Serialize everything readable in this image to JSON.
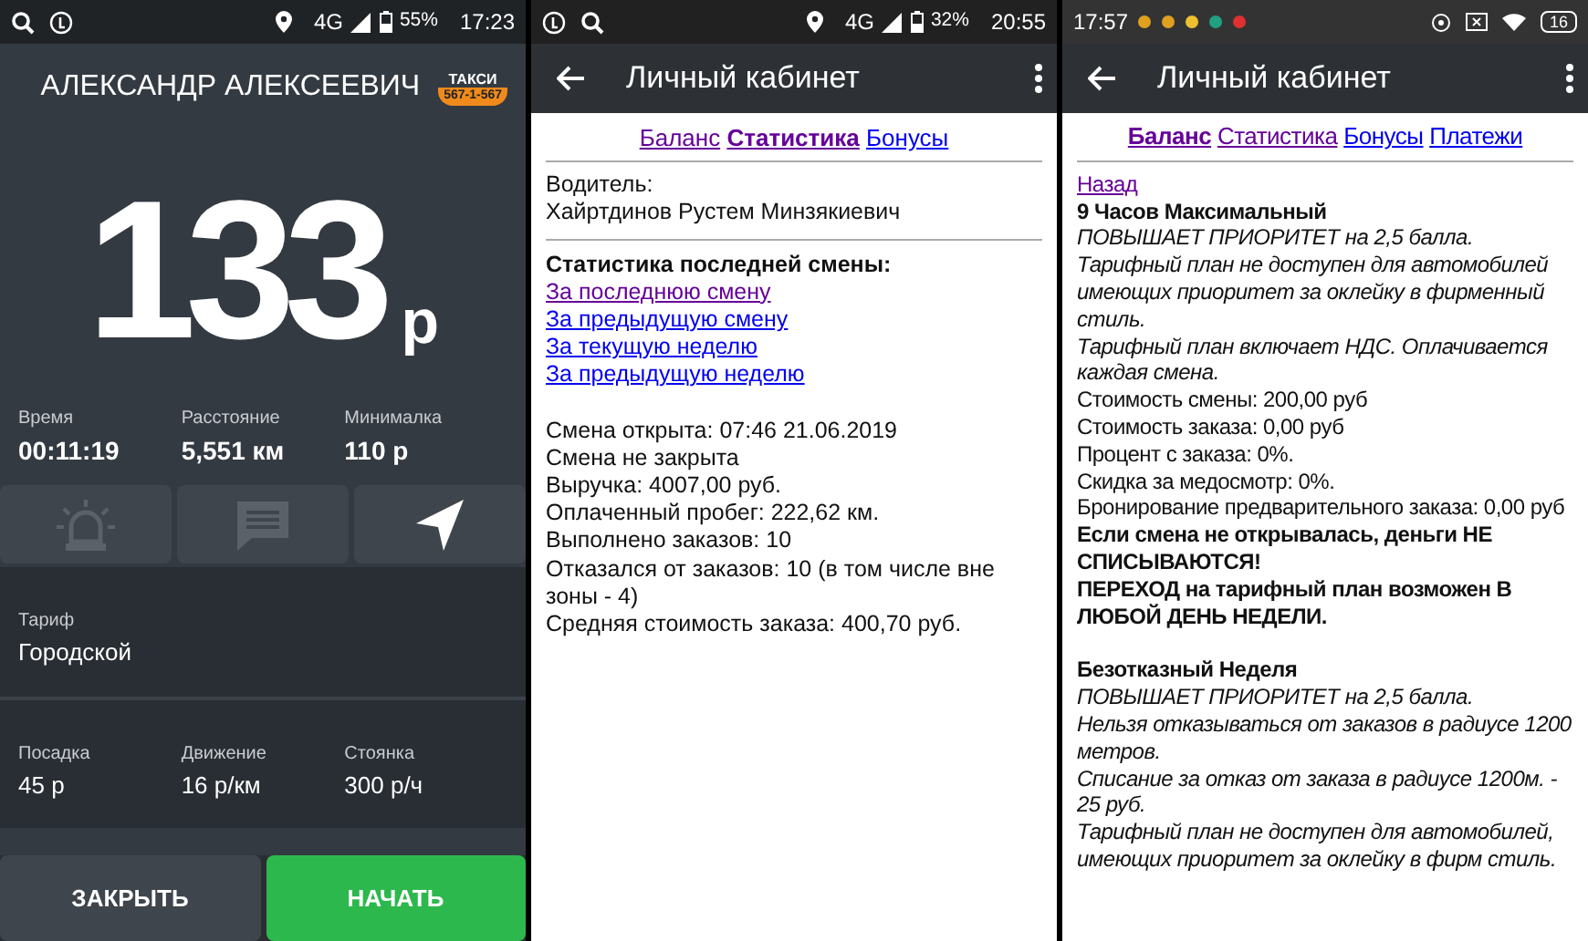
{
  "taximeter_screen": {
    "status_bar": {
      "network": "4G",
      "battery": "55%",
      "time": "17:23"
    },
    "driver_name": "АЛЕКСАНДР АЛЕКСЕЕВИЧ",
    "logo": {
      "line_1": "ТАКСИ",
      "line_2": "567-1-567"
    },
    "fare": {
      "amount": "133",
      "currency": "р"
    },
    "trip_stats": [
      {
        "label": "Время",
        "value": "00:11:19"
      },
      {
        "label": "Расстояние",
        "value": "5,551 км"
      },
      {
        "label": "Минималка",
        "value": "110 р"
      }
    ],
    "action_buttons": [
      {
        "kind": "siren",
        "disabled": true
      },
      {
        "kind": "chat",
        "disabled": true
      },
      {
        "kind": "navigate",
        "disabled": false
      }
    ],
    "tariff": {
      "label": "Тариф",
      "value": "Городской"
    },
    "rates": [
      {
        "label": "Посадка",
        "value": "45 р"
      },
      {
        "label": "Движение",
        "value": "16 р/км"
      },
      {
        "label": "Стоянка",
        "value": "300 р/ч"
      }
    ],
    "buttons": [
      {
        "label": "ЗАКРЫТЬ",
        "kind": "secondary"
      },
      {
        "label": "НАЧАТЬ",
        "kind": "primary"
      }
    ]
  },
  "statistics_screen": {
    "status_bar": {
      "network": "4G",
      "battery": "32%",
      "time": "20:55"
    },
    "toolbar": {
      "title": "Личный кабинет"
    },
    "tabs": [
      {
        "label": "Баланс",
        "selected": false,
        "visited": true
      },
      {
        "label": "Статистика",
        "selected": true,
        "visited": true
      },
      {
        "label": "Бонусы",
        "selected": false,
        "visited": false
      }
    ],
    "driver": {
      "label": "Водитель:",
      "name": "Хайртдинов Рустем Минзякиевич"
    },
    "stats_heading": "Статистика последней смены:",
    "period_links": [
      {
        "label": "За последнюю смену",
        "visited": true
      },
      {
        "label": "За предыдущую смену",
        "visited": false
      },
      {
        "label": "За текущую неделю",
        "visited": false
      },
      {
        "label": "За предыдущую неделю",
        "visited": false
      }
    ],
    "details": [
      "Смена открыта: 07:46 21.06.2019",
      "Смена не закрыта",
      "Выручка: 4007,00 руб.",
      "Оплаченный пробег: 222,62 км.",
      "Выполнено заказов: 10",
      "Отказался от заказов: 10 (в том числе вне зоны - 4)",
      "Средняя стоимость заказа: 400,70 руб."
    ]
  },
  "tariffs_screen": {
    "status_bar": {
      "time": "17:57",
      "battery": "16",
      "notifications": [
        {
          "color": "#e0a020"
        },
        {
          "color": "#e0a020"
        },
        {
          "color": "#f0c030"
        },
        {
          "color": "#20a080"
        },
        {
          "color": "#e03030"
        }
      ]
    },
    "toolbar": {
      "title": "Личный кабинет"
    },
    "tabs": [
      {
        "label": "Баланс",
        "selected": true,
        "visited": true
      },
      {
        "label": "Статистика",
        "selected": false,
        "visited": true
      },
      {
        "label": "Бонусы",
        "selected": false,
        "visited": false
      },
      {
        "label": "Платежи",
        "selected": false,
        "visited": false
      }
    ],
    "back_link": {
      "label": "Назад",
      "visited": true
    },
    "plans": [
      {
        "title": "9 Часов Максимальный",
        "lines": [
          {
            "kind": "note",
            "text": "ПОВЫШАЕТ ПРИОРИТЕТ на 2,5 балла."
          },
          {
            "kind": "note",
            "text": "Тарифный план не доступен для автомобилей имеющих приоритет за оклейку в фирменный стиль."
          },
          {
            "kind": "note",
            "text": "Тарифный план включает НДС. Оплачивается каждая смена."
          },
          {
            "kind": "text",
            "text": "Стоимость смены: 200,00 руб"
          },
          {
            "kind": "text",
            "text": "Стоимость заказа: 0,00 руб"
          },
          {
            "kind": "text",
            "text": "Процент с заказа: 0%."
          },
          {
            "kind": "text",
            "text": "Скидка за медосмотр: 0%."
          },
          {
            "kind": "text",
            "text": "Бронирование предварительного заказа: 0,00 руб"
          },
          {
            "kind": "warning",
            "text": "Если смена не открывалась, деньги НЕ СПИСЫВАЮТСЯ!"
          },
          {
            "kind": "warning",
            "text": "ПЕРЕХОД на тарифный план возможен В ЛЮБОЙ ДЕНЬ НЕДЕЛИ."
          }
        ]
      },
      {
        "title": "Безотказный Неделя",
        "lines": [
          {
            "kind": "note",
            "text": "ПОВЫШАЕТ ПРИОРИТЕТ на 2,5 балла."
          },
          {
            "kind": "note",
            "text": "Нельзя отказываться от заказов в радиусе 1200 метров."
          },
          {
            "kind": "note",
            "text": "Списание за отказ от заказа в радиусе 1200м. - 25 руб."
          },
          {
            "kind": "note",
            "text": "Тарифный план не доступен для автомобилей, имеющих приоритет за оклейку в фирм стиль."
          }
        ]
      }
    ]
  }
}
